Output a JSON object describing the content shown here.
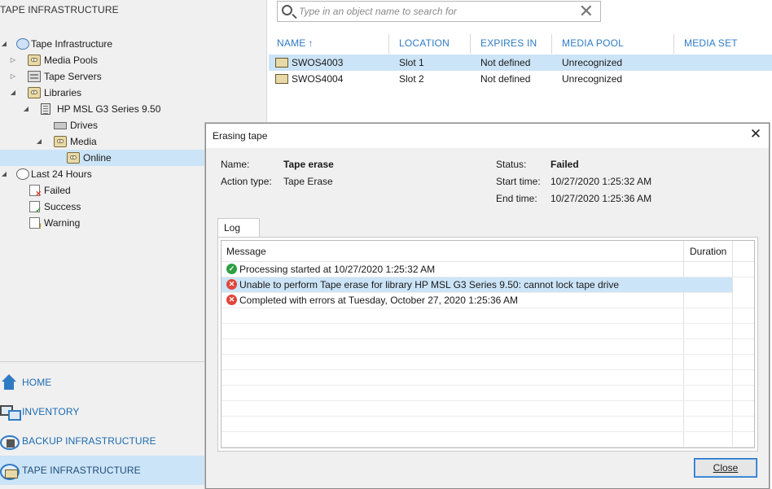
{
  "left_pane": {
    "title": "TAPE INFRASTRUCTURE",
    "tree": [
      {
        "label": "Tape Infrastructure",
        "icon": "tape-infrastructure-icon",
        "expander": "expanded"
      },
      {
        "label": "Media Pools",
        "icon": "media-pools-icon",
        "expander": "collapsed"
      },
      {
        "label": "Tape Servers",
        "icon": "tape-servers-icon",
        "expander": "collapsed"
      },
      {
        "label": "Libraries",
        "icon": "libraries-icon",
        "expander": "expanded"
      },
      {
        "label": "HP MSL G3 Series 9.50",
        "icon": "library-icon",
        "expander": "expanded"
      },
      {
        "label": "Drives",
        "icon": "drives-icon",
        "expander": "none"
      },
      {
        "label": "Media",
        "icon": "media-icon",
        "expander": "expanded"
      },
      {
        "label": "Online",
        "icon": "online-media-icon",
        "expander": "none"
      },
      {
        "label": "Last 24 Hours",
        "icon": "last-24-hours-icon",
        "expander": "expanded"
      },
      {
        "label": "Failed",
        "icon": "failed-icon",
        "expander": "none"
      },
      {
        "label": "Success",
        "icon": "success-icon",
        "expander": "none"
      },
      {
        "label": "Warning",
        "icon": "warning-icon",
        "expander": "none"
      }
    ],
    "nav": [
      {
        "label": "HOME",
        "icon": "home-icon"
      },
      {
        "label": "INVENTORY",
        "icon": "inventory-icon"
      },
      {
        "label": "BACKUP INFRASTRUCTURE",
        "icon": "backup-infrastructure-icon"
      },
      {
        "label": "TAPE INFRASTRUCTURE",
        "icon": "tape-infrastructure-nav-icon"
      }
    ]
  },
  "search": {
    "placeholder": "Type in an object name to search for",
    "value": "",
    "clear_glyph": "✕"
  },
  "grid": {
    "columns": [
      "NAME",
      "LOCATION",
      "EXPIRES IN",
      "MEDIA POOL",
      "MEDIA SET"
    ],
    "sort_glyph": "↑",
    "rows": [
      {
        "name": "SWOS4003",
        "location": "Slot 1",
        "expires": "Not defined",
        "pool": "Unrecognized",
        "set": ""
      },
      {
        "name": "SWOS4004",
        "location": "Slot 2",
        "expires": "Not defined",
        "pool": "Unrecognized",
        "set": ""
      }
    ]
  },
  "dialog": {
    "title": "Erasing tape",
    "close_glyph": "✕",
    "name_label": "Name:",
    "name_value": "Tape erase",
    "action_label": "Action type:",
    "action_value": "Tape Erase",
    "status_label": "Status:",
    "status_value": "Failed",
    "start_label": "Start time:",
    "start_value": "10/27/2020 1:25:32 AM",
    "end_label": "End time:",
    "end_value": "10/27/2020 1:25:36 AM",
    "tab_label": "Log",
    "log_headers": {
      "message": "Message",
      "duration": "Duration"
    },
    "log": [
      {
        "status": "success",
        "message": "Processing started at 10/27/2020 1:25:32 AM",
        "duration": ""
      },
      {
        "status": "error",
        "message": "Unable to perform Tape erase for library HP MSL G3 Series 9.50: cannot lock tape drive",
        "duration": ""
      },
      {
        "status": "error",
        "message": "Completed with errors at Tuesday, October 27, 2020 1:25:36 AM",
        "duration": ""
      }
    ],
    "close_button": "Close"
  },
  "colors": {
    "accent": "#2f7bc4",
    "selection": "#cce4f7",
    "error": "#e0463b",
    "success": "#2ea043"
  }
}
